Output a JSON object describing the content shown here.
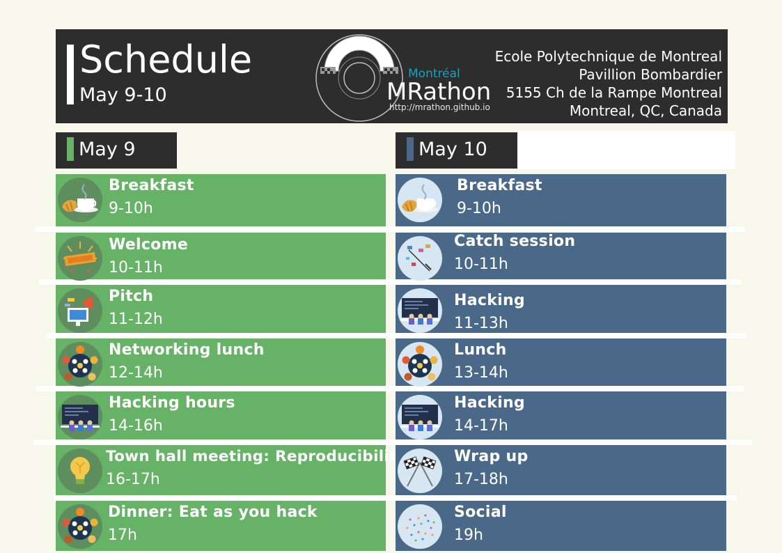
{
  "header": {
    "title": "Schedule",
    "dates": "May 9-10",
    "brand_city": "Montréal",
    "brand_name": "MRathon",
    "brand_url": "http://mrathon.github.io",
    "address": [
      "Ecole Polytechnique de Montreal",
      "Pavillion Bombardier",
      "5155 Ch de la Rampe Montreal",
      "Montreal, QC, Canada"
    ]
  },
  "colors": {
    "day1": "#66b266",
    "day2": "#4a6988",
    "dark": "#2d2d2d",
    "background": "#f7f7ec",
    "brand_accent": "#1aa0b8"
  },
  "days": [
    {
      "label": "May 9",
      "events": [
        {
          "name": "Breakfast",
          "time": "9-10h",
          "icon": "coffee-croissant-icon"
        },
        {
          "name": "Welcome",
          "time": "10-11h",
          "icon": "welcome-ribbon-icon"
        },
        {
          "name": "Pitch",
          "time": "11-12h",
          "icon": "presentation-megaphone-icon"
        },
        {
          "name": "Networking lunch",
          "time": "12-14h",
          "icon": "lunch-table-icon"
        },
        {
          "name": "Hacking hours",
          "time": "14-16h",
          "icon": "hacking-team-icon"
        },
        {
          "name": "Town hall meeting: Reproducibility",
          "time": "16-17h",
          "icon": "lightbulb-icon"
        },
        {
          "name": "Dinner: Eat as you hack",
          "time": "17h",
          "icon": "lunch-table-icon"
        }
      ]
    },
    {
      "label": "May 10",
      "events": [
        {
          "name": "Breakfast",
          "time": "9-10h",
          "icon": "coffee-croissant-icon"
        },
        {
          "name": "Catch session",
          "time": "10-11h",
          "icon": "flags-string-icon"
        },
        {
          "name": "Hacking",
          "time": "11-13h",
          "icon": "hacking-team-icon"
        },
        {
          "name": "Lunch",
          "time": "13-14h",
          "icon": "lunch-table-icon"
        },
        {
          "name": "Hacking",
          "time": "14-17h",
          "icon": "hacking-team-icon"
        },
        {
          "name": "Wrap up",
          "time": "17-18h",
          "icon": "checkered-flags-icon"
        },
        {
          "name": "Social",
          "time": "19h",
          "icon": "confetti-icon"
        }
      ]
    }
  ]
}
